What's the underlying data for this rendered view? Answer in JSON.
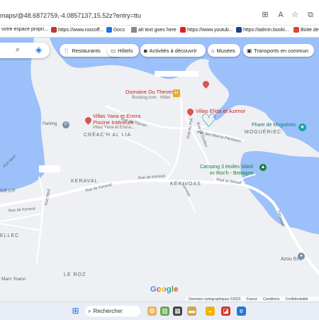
{
  "browser": {
    "url": "maps/@48.6872759,-4.0857137,15.52z?entry=ttu"
  },
  "bookmarks": [
    {
      "label": "votre espace propri...",
      "color": "#1a73e8"
    },
    {
      "label": "https://www.roscoff...",
      "color": "#c0392b"
    },
    {
      "label": "Docs",
      "color": "#1a73e8"
    },
    {
      "label": "alt text goes here",
      "color": "#888888"
    },
    {
      "label": "https://www.youtub...",
      "color": "#e02020"
    },
    {
      "label": "https://admin.booki...",
      "color": "#1d3f8e"
    },
    {
      "label": "Boite de",
      "color": "#e0432f"
    }
  ],
  "chips": [
    {
      "label": "Restaurants",
      "icon": "fork-knife-icon"
    },
    {
      "label": "Hôtels",
      "icon": "bed-icon"
    },
    {
      "label": "Activités à découvrir",
      "icon": "camera-icon"
    },
    {
      "label": "Musées",
      "icon": "museum-icon"
    },
    {
      "label": "Transports en commun",
      "icon": "train-icon"
    }
  ],
  "places": {
    "domaine": "Domaine Du Theven",
    "domaine_sub": "Booking.com · Hôtel",
    "villas_yana_1": "Villas Yana et Enora",
    "villas_yana_2": "Piscine Intérieure",
    "villas_yana_sub": "Villas Yana et Enora...",
    "villas_elida": "Villas Elida et Azenor",
    "parking": "Parking",
    "phare": "Phare de Moguériec",
    "camping_1": "Camping 3 étoiles Sibiril",
    "camping_2": "Ar Roc'h - Bretagne",
    "azou": "Azou Eric"
  },
  "areas": {
    "creach": "CRÉAC'H AL LIA",
    "mogueriec": "MOGUÉRIEC",
    "keraval": "KERAVAL",
    "kerivoas": "KÉRIVOAS",
    "neuf": "NEUF",
    "ellec": "ELLEC",
    "le_roz": "LE ROZ",
    "marc": "Marc Yoann"
  },
  "roads": {
    "theven": "Rue de Theven",
    "guelen": "Rue du Guelen",
    "marins": "Rue des Marins Pêcheurs",
    "keraval_1": "Rue de Keraval",
    "keraval_2": "Rue de Keraval",
    "keraval_3": "Rue de Keraval",
    "poul": "Poul ar Stread",
    "port_neuf_1": "Port Neuf",
    "port_neuf_2": "Port Neuf",
    "kervoas": "Kervoas",
    "kerouzon": "Kerouzon",
    "puit": "Rue du Puit"
  },
  "attribution": {
    "data": "Données cartographiques ©2023",
    "country": "France",
    "terms": "Conditions",
    "privacy": "Confidentialité"
  },
  "google": "Google",
  "taskbar": {
    "search": "Rechercher"
  },
  "colors": {
    "water": "#9cc0f9",
    "land": "#eef0f3",
    "road": "#ffffff",
    "place_red": "#c5221f",
    "poi_green": "#188038",
    "heart": "#1aa3a3"
  }
}
